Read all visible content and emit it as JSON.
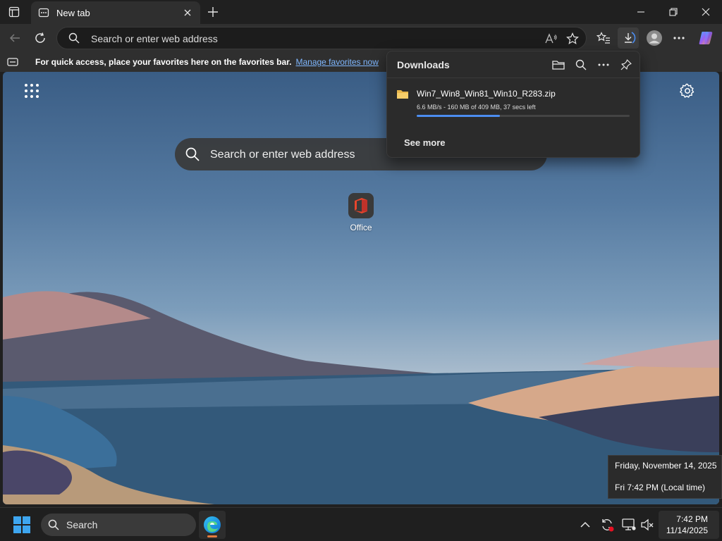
{
  "window": {
    "tab_title": "New tab",
    "minimize_icon": "minimize-icon",
    "restore_icon": "restore-icon",
    "close_icon": "close-icon"
  },
  "toolbar": {
    "address_placeholder": "Search or enter web address",
    "back_icon": "back-arrow-icon",
    "refresh_icon": "refresh-icon",
    "read_aloud_icon": "read-aloud-icon",
    "favorite_icon": "star-icon",
    "favorites_icon": "favorites-list-icon",
    "downloads_icon": "download-icon",
    "profile_icon": "profile-avatar-icon",
    "menu_icon": "more-options-icon",
    "copilot_icon": "copilot-icon"
  },
  "favorites_bar": {
    "message": "For quick access, place your favorites here on the favorites bar.",
    "link": "Manage favorites now"
  },
  "new_tab_page": {
    "search_placeholder": "Search or enter web address",
    "quick_links": [
      {
        "label": "Office",
        "icon": "office-icon"
      }
    ]
  },
  "downloads": {
    "title": "Downloads",
    "items": [
      {
        "file_name": "Win7_Win8_Win81_Win10_R283.zip",
        "status": "6.6 MB/s - 160 MB of 409 MB, 37 secs left",
        "progress": 0.39
      }
    ],
    "see_more": "See more"
  },
  "clock_tooltip": {
    "date_line": "Friday, November 14, 2025",
    "time_line": "Fri 7:42 PM (Local time)"
  },
  "taskbar": {
    "search_label": "Search",
    "time": "7:42 PM",
    "date": "11/14/2025"
  },
  "colors": {
    "accent": "#4c8df0",
    "link": "#7fb7ff",
    "edge_indicator": "#e47b3f",
    "recording_dot": "#e81123"
  }
}
